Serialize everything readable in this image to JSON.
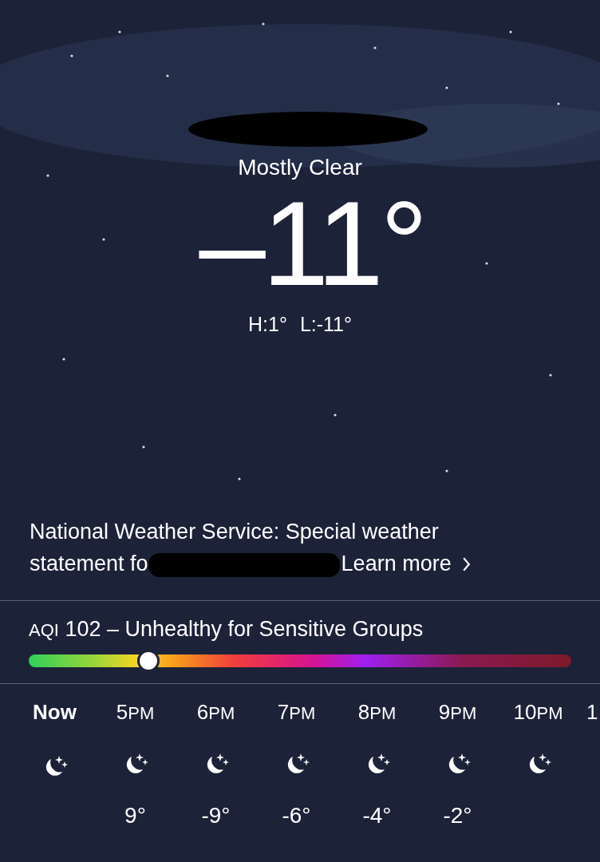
{
  "current": {
    "condition": "Mostly Clear",
    "temperature": "–11°",
    "high": "H:1°",
    "low": "L:-11°"
  },
  "alert": {
    "text": "National Weather Service: Special weather statement fo",
    "link": "Learn more"
  },
  "aqi": {
    "label": "AQI",
    "value": "102",
    "separator": "–",
    "category": "Unhealthy for Sensitive Groups",
    "level": 0.22
  },
  "hourly": [
    {
      "hour": "Now",
      "kind": "now"
    },
    {
      "hour": "5",
      "period": "PM",
      "kind": "hour",
      "temp": "9°"
    },
    {
      "hour": "6",
      "period": "PM",
      "kind": "hour",
      "temp": "-9°"
    },
    {
      "hour": "7",
      "period": "PM",
      "kind": "hour",
      "temp": "-6°"
    },
    {
      "hour": "8",
      "period": "PM",
      "kind": "hour",
      "temp": "-4°"
    },
    {
      "hour": "9",
      "period": "PM",
      "kind": "hour",
      "temp": "-2°"
    },
    {
      "hour": "10",
      "period": "PM",
      "kind": "hour"
    },
    {
      "hour": "1",
      "kind": "cut"
    }
  ]
}
